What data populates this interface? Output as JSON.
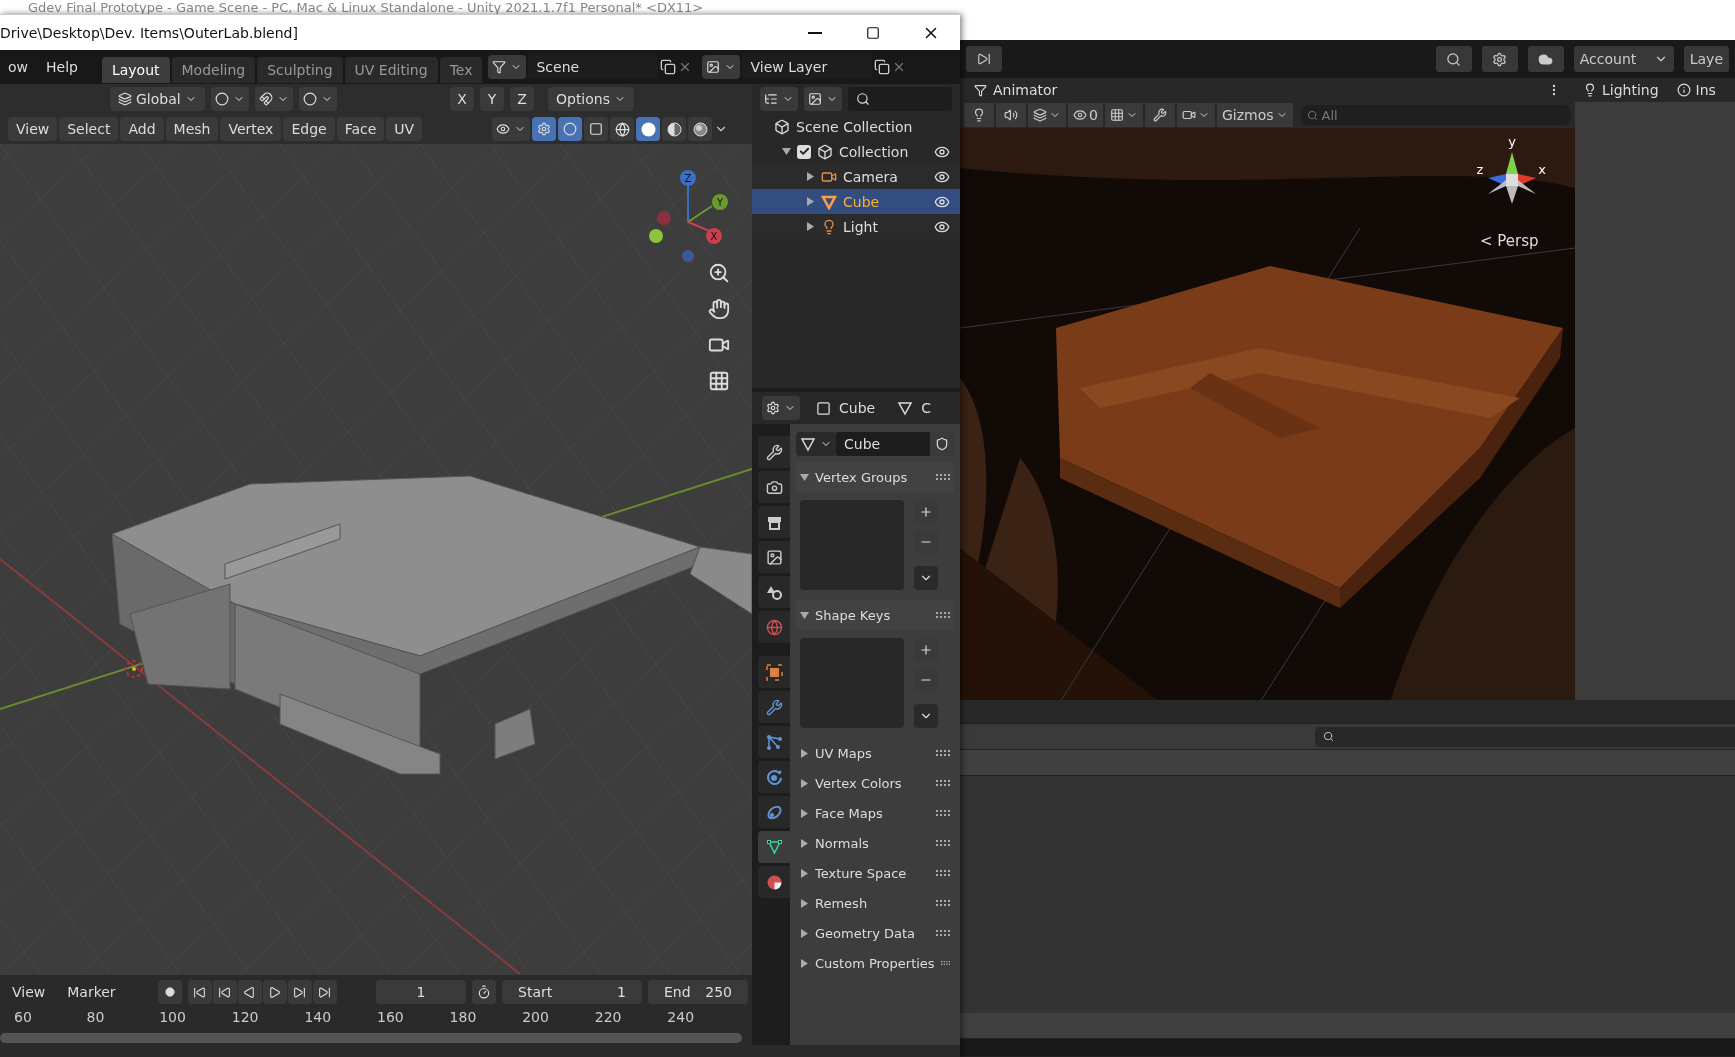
{
  "unity_title": "Gdev Final Prototype - Game Scene - PC, Mac & Linux Standalone - Unity 2021.1.7f1 Personal* <DX11>",
  "blender": {
    "title": "Drive\\Desktop\\Dev. Items\\OuterLab.blend]",
    "menu": [
      "ow",
      "Help"
    ],
    "workspaces": [
      {
        "label": "Layout",
        "selected": true
      },
      {
        "label": "Modeling",
        "selected": false
      },
      {
        "label": "Sculpting",
        "selected": false
      },
      {
        "label": "UV Editing",
        "selected": false
      },
      {
        "label": "Tex",
        "selected": false
      }
    ],
    "scene": "Scene",
    "view_layer": "View Layer",
    "orientation": "Global",
    "snap_on": false,
    "proportional_on": false,
    "axes": [
      "X",
      "Y",
      "Z"
    ],
    "options": "Options",
    "viewport_menu": [
      "View",
      "Select",
      "Add",
      "Mesh",
      "Vertex",
      "Edge",
      "Face",
      "UV"
    ],
    "gizmos_on": true,
    "overlays_on": true,
    "xray_on": false,
    "shading": [
      {
        "kind": "wireframe",
        "selected": false
      },
      {
        "kind": "solid",
        "selected": true
      },
      {
        "kind": "material",
        "selected": false
      },
      {
        "kind": "rendered",
        "selected": false
      }
    ],
    "gizmo_axes": [
      "Z",
      "Y",
      "X"
    ],
    "outliner": {
      "root": "Scene Collection",
      "items": [
        {
          "label": "Collection",
          "kind": "collection",
          "checked": true,
          "expanded": true,
          "selected": false,
          "children": [
            {
              "label": "Camera",
              "kind": "camera",
              "selected": false
            },
            {
              "label": "Cube",
              "kind": "mesh",
              "selected": true
            },
            {
              "label": "Light",
              "kind": "light",
              "selected": false
            }
          ]
        }
      ]
    },
    "properties": {
      "object": "Cube",
      "data_kind": "C",
      "data_name": "Cube",
      "tabs": [
        {
          "kind": "tool",
          "selected": false
        },
        {
          "kind": "render",
          "selected": false
        },
        {
          "kind": "output",
          "selected": false
        },
        {
          "kind": "view_layer",
          "selected": false
        },
        {
          "kind": "scene",
          "selected": false
        },
        {
          "kind": "world",
          "selected": false
        },
        {
          "kind": "object",
          "selected": false
        },
        {
          "kind": "modifier",
          "selected": false
        },
        {
          "kind": "particles",
          "selected": false
        },
        {
          "kind": "physics",
          "selected": false
        },
        {
          "kind": "constraints",
          "selected": false
        },
        {
          "kind": "data",
          "selected": true
        },
        {
          "kind": "material",
          "selected": false
        }
      ],
      "panels": [
        {
          "label": "Vertex Groups",
          "expanded": true
        },
        {
          "label": "Shape Keys",
          "expanded": true
        },
        {
          "label": "UV Maps",
          "expanded": false
        },
        {
          "label": "Vertex Colors",
          "expanded": false
        },
        {
          "label": "Face Maps",
          "expanded": false
        },
        {
          "label": "Normals",
          "expanded": false
        },
        {
          "label": "Texture Space",
          "expanded": false
        },
        {
          "label": "Remesh",
          "expanded": false
        },
        {
          "label": "Geometry Data",
          "expanded": false
        },
        {
          "label": "Custom Properties",
          "expanded": false
        }
      ]
    },
    "timeline": {
      "menu": [
        "View",
        "Marker"
      ],
      "current_frame": "1",
      "start_label": "Start",
      "start": "1",
      "end_label": "End",
      "end": "250",
      "ticks": [
        "60",
        "80",
        "100",
        "120",
        "140",
        "160",
        "180",
        "200",
        "220",
        "240"
      ]
    }
  },
  "unity": {
    "account": "Account",
    "layers": "Laye",
    "scene_tab": "Animator",
    "hidden_count": "0",
    "gizmos": "Gizmos",
    "search_placeholder": "All",
    "axes": [
      "y",
      "z",
      "x"
    ],
    "persp": "< Persp",
    "side_tabs": [
      {
        "label": "Lighting",
        "kind": "lighting"
      },
      {
        "label": "Ins",
        "kind": "info"
      }
    ]
  }
}
